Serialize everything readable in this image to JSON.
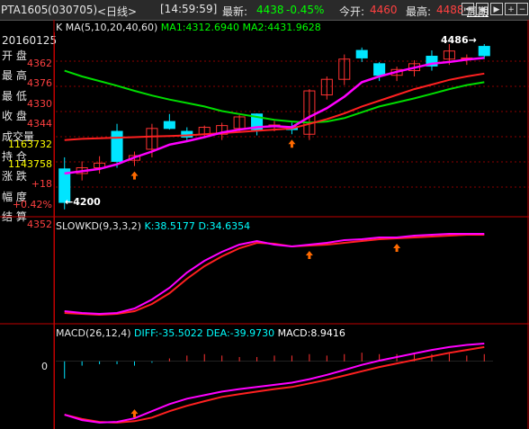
{
  "titlebar": {
    "code": "PTA1605",
    "code_num": "(030705)",
    "period": "<日线>",
    "time": "[14:59:59]",
    "last_label": "最新:",
    "last_value": "4438",
    "change_pct": "-0.45%",
    "open_label": "今开:",
    "open_value": "4460",
    "high_label": "最高:",
    "high_value": "4488",
    "cycle_label": "周期",
    "icons": [
      "nav-first-icon",
      "nav-prev-icon",
      "nav-next-icon",
      "nav-last-icon",
      "zoom-in-icon",
      "zoom-out-icon"
    ]
  },
  "ma_header": {
    "k": "K",
    "ma": "MA(5,10,20,40,60)",
    "ma1": "MA1:4312.6940",
    "ma2": "MA2:4431.9628"
  },
  "side_panel": {
    "date": "20160125",
    "fields": [
      {
        "label": "开  盘",
        "value": "4362",
        "color": "#ff4040"
      },
      {
        "label": "最  高",
        "value": "4376",
        "color": "#ff4040"
      },
      {
        "label": "最  低",
        "value": "4330",
        "color": "#ff4040"
      },
      {
        "label": "收  盘",
        "value": "4344",
        "color": "#ff4040"
      },
      {
        "label": "成交量",
        "value": "1163732",
        "color": "#ffff00"
      },
      {
        "label": "持  仓",
        "value": "1143758",
        "color": "#ffff00"
      },
      {
        "label": "涨  跌",
        "value": "+18",
        "color": "#ff4040"
      },
      {
        "label": "幅  度",
        "value": "+0.42%",
        "color": "#ff4040"
      },
      {
        "label": "结  算",
        "value": "4352",
        "color": "#ff4040"
      }
    ]
  },
  "annotations": {
    "high_mark": "4486",
    "low_mark": "4200"
  },
  "kd_header": {
    "name": "SLOWKD(9,3,3,2)",
    "k": "K:38.5177",
    "d": "D:34.6354"
  },
  "macd_header": {
    "name": "MACD(26,12,4)",
    "diff": "DIFF:-35.5022",
    "dea": "DEA:-39.9730",
    "macd": "MACD:8.9416",
    "zero_label": "0"
  },
  "colors": {
    "up": "#ff3232",
    "down": "#00e5ff",
    "ma_magenta": "#ff00ff",
    "ma_green": "#00dd00",
    "grid": "#8b0000",
    "divider": "#c00000",
    "arrow": "#ff6a00"
  },
  "chart_data": {
    "type": "candlestick",
    "candles": [
      {
        "o": 4270,
        "h": 4290,
        "l": 4200,
        "c": 4212
      },
      {
        "o": 4262,
        "h": 4283,
        "l": 4250,
        "c": 4272
      },
      {
        "o": 4272,
        "h": 4292,
        "l": 4262,
        "c": 4280
      },
      {
        "o": 4335,
        "h": 4348,
        "l": 4272,
        "c": 4283
      },
      {
        "o": 4285,
        "h": 4300,
        "l": 4275,
        "c": 4293
      },
      {
        "o": 4304,
        "h": 4348,
        "l": 4290,
        "c": 4340
      },
      {
        "o": 4352,
        "h": 4365,
        "l": 4338,
        "c": 4340
      },
      {
        "o": 4335,
        "h": 4342,
        "l": 4318,
        "c": 4325
      },
      {
        "o": 4330,
        "h": 4345,
        "l": 4325,
        "c": 4342
      },
      {
        "o": 4330,
        "h": 4350,
        "l": 4320,
        "c": 4345
      },
      {
        "o": 4340,
        "h": 4363,
        "l": 4335,
        "c": 4360
      },
      {
        "o": 4365,
        "h": 4366,
        "l": 4328,
        "c": 4338
      },
      {
        "o": 4345,
        "h": 4353,
        "l": 4335,
        "c": 4346
      },
      {
        "o": 4343,
        "h": 4350,
        "l": 4330,
        "c": 4338
      },
      {
        "o": 4330,
        "h": 4408,
        "l": 4320,
        "c": 4405
      },
      {
        "o": 4398,
        "h": 4430,
        "l": 4390,
        "c": 4425
      },
      {
        "o": 4425,
        "h": 4468,
        "l": 4415,
        "c": 4460
      },
      {
        "o": 4475,
        "h": 4480,
        "l": 4455,
        "c": 4462
      },
      {
        "o": 4452,
        "h": 4455,
        "l": 4422,
        "c": 4432
      },
      {
        "o": 4432,
        "h": 4447,
        "l": 4422,
        "c": 4442
      },
      {
        "o": 4440,
        "h": 4458,
        "l": 4430,
        "c": 4452
      },
      {
        "o": 4465,
        "h": 4475,
        "l": 4440,
        "c": 4448
      },
      {
        "o": 4460,
        "h": 4486,
        "l": 4450,
        "c": 4474
      },
      {
        "o": 4462,
        "h": 4468,
        "l": 4450,
        "c": 4462
      },
      {
        "o": 4482,
        "h": 4486,
        "l": 4460,
        "c": 4466
      }
    ],
    "ma1": [
      4262,
      4266,
      4270,
      4278,
      4290,
      4300,
      4312,
      4318,
      4325,
      4333,
      4338,
      4342,
      4344,
      4342,
      4360,
      4375,
      4395,
      4420,
      4430,
      4438,
      4445,
      4452,
      4455,
      4459,
      4462
    ],
    "ma2": [
      4440,
      4430,
      4422,
      4414,
      4405,
      4397,
      4390,
      4384,
      4378,
      4370,
      4365,
      4360,
      4355,
      4352,
      4350,
      4352,
      4358,
      4368,
      4378,
      4385,
      4392,
      4400,
      4408,
      4415,
      4420
    ],
    "ma3": [
      4320,
      4322,
      4323,
      4324,
      4325,
      4326,
      4327,
      4328,
      4330,
      4332,
      4334,
      4336,
      4338,
      4340,
      4348,
      4356,
      4366,
      4378,
      4388,
      4398,
      4408,
      4416,
      4424,
      4430,
      4435
    ],
    "ylim": [
      4195,
      4500
    ],
    "kd_k": [
      12,
      10,
      9,
      10,
      15,
      25,
      38,
      55,
      68,
      78,
      86,
      90,
      86,
      84,
      86,
      88,
      91,
      92,
      94,
      94,
      96,
      97,
      98,
      98,
      98
    ],
    "kd_d": [
      10,
      9,
      8,
      9,
      12,
      20,
      32,
      48,
      62,
      73,
      82,
      88,
      87,
      84,
      85,
      86,
      88,
      90,
      92,
      93,
      94,
      95,
      96,
      97,
      97
    ],
    "kd_ylim": [
      0,
      100
    ],
    "macd_diff": [
      -150,
      -165,
      -172,
      -170,
      -160,
      -140,
      -120,
      -105,
      -95,
      -85,
      -78,
      -72,
      -66,
      -60,
      -50,
      -38,
      -24,
      -10,
      2,
      12,
      22,
      32,
      40,
      46,
      50
    ],
    "macd_dea": [
      -150,
      -162,
      -170,
      -172,
      -168,
      -158,
      -140,
      -125,
      -112,
      -100,
      -92,
      -85,
      -78,
      -72,
      -62,
      -52,
      -40,
      -28,
      -16,
      -6,
      4,
      14,
      24,
      32,
      40
    ],
    "macd_bars": [
      -12,
      -3,
      -2,
      -2,
      -3,
      -1,
      2,
      4,
      5,
      4,
      3,
      3,
      4,
      4,
      5,
      4,
      5,
      6,
      5,
      5,
      6,
      5,
      6,
      4,
      5
    ],
    "macd_ylim": [
      -185,
      60
    ]
  }
}
